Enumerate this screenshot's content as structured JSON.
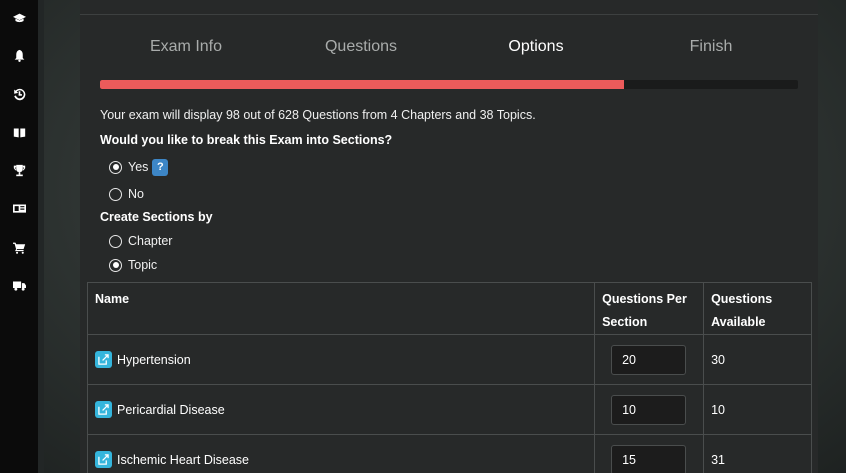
{
  "sidebar": {
    "icons": [
      "graduation-cap-icon",
      "bell-icon",
      "history-icon",
      "book-icon",
      "trophy-icon",
      "id-card-icon",
      "cart-icon",
      "truck-icon"
    ]
  },
  "wizard": {
    "tabs": [
      {
        "label": "Exam Info"
      },
      {
        "label": "Questions"
      },
      {
        "label": "Options"
      },
      {
        "label": "Finish"
      }
    ],
    "active_tab": "Options",
    "progress_fraction": 0.75,
    "progress_color": "#ec5b5b"
  },
  "summary": "Your exam will display 98 out of 628 Questions from 4 Chapters and 38 Topics.",
  "sections_question": {
    "label": "Would you like to break this Exam into Sections?",
    "options": [
      {
        "label": "Yes",
        "checked": true,
        "help": "?"
      },
      {
        "label": "No",
        "checked": false
      }
    ]
  },
  "create_by": {
    "label": "Create Sections by",
    "options": [
      {
        "label": "Chapter",
        "checked": false
      },
      {
        "label": "Topic",
        "checked": true
      }
    ]
  },
  "table": {
    "headers": {
      "name": "Name",
      "per_section": "Questions Per Section",
      "available": "Questions Available"
    },
    "rows": [
      {
        "name": "Hypertension",
        "per_section": "20",
        "available": "30"
      },
      {
        "name": "Pericardial Disease",
        "per_section": "10",
        "available": "10"
      },
      {
        "name": "Ischemic Heart Disease",
        "per_section": "15",
        "available": "31"
      }
    ]
  },
  "colors": {
    "accent_blue": "#3d86c6",
    "edit_icon": "#35b5dc"
  }
}
